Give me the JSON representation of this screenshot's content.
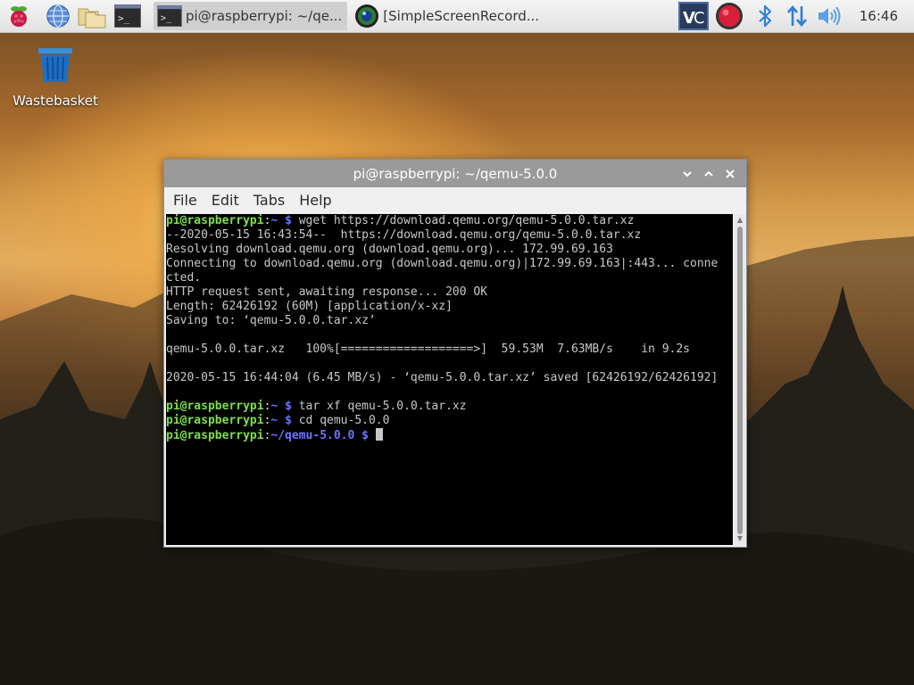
{
  "taskbar": {
    "tasks": [
      {
        "label": "pi@raspberrypi: ~/qe...",
        "icon": "terminal-icon"
      },
      {
        "label": "[SimpleScreenRecord...",
        "icon": "simplescreenrecorder-icon"
      }
    ],
    "clock": "16:46",
    "launchers": [
      "raspberry-menu-icon",
      "web-browser-icon",
      "file-manager-icon",
      "terminal-icon"
    ],
    "tray": [
      "vnc-icon",
      "record-icon",
      "bluetooth-icon",
      "network-icon",
      "volume-icon"
    ]
  },
  "desktop": {
    "icons": [
      {
        "label": "Wastebasket",
        "icon": "wastebasket-icon"
      }
    ]
  },
  "window": {
    "title": "pi@raspberrypi: ~/qemu-5.0.0",
    "menu": [
      "File",
      "Edit",
      "Tabs",
      "Help"
    ]
  },
  "terminal": {
    "prompt_user": "pi@raspberrypi",
    "prompt_home": "~",
    "prompt_dir": "~/qemu-5.0.0",
    "prompt_sep": ":",
    "prompt_dollar": "$",
    "cmd_wget": "wget https://download.qemu.org/qemu-5.0.0.tar.xz",
    "output": [
      "--2020-05-15 16:43:54--  https://download.qemu.org/qemu-5.0.0.tar.xz",
      "Resolving download.qemu.org (download.qemu.org)... 172.99.69.163",
      "Connecting to download.qemu.org (download.qemu.org)|172.99.69.163|:443... conne",
      "cted.",
      "HTTP request sent, awaiting response... 200 OK",
      "Length: 62426192 (60M) [application/x-xz]",
      "Saving to: ‘qemu-5.0.0.tar.xz’",
      "",
      "qemu-5.0.0.tar.xz   100%[===================>]  59.53M  7.63MB/s    in 9.2s",
      "",
      "2020-05-15 16:44:04 (6.45 MB/s) - ‘qemu-5.0.0.tar.xz’ saved [62426192/62426192]",
      ""
    ],
    "cmd_tar": "tar xf qemu-5.0.0.tar.xz",
    "cmd_cd": "cd qemu-5.0.0"
  },
  "colors": {
    "prompt_user": "#7be04a",
    "prompt_path": "#6f74ff",
    "titlebar": "#9a9a9a"
  }
}
